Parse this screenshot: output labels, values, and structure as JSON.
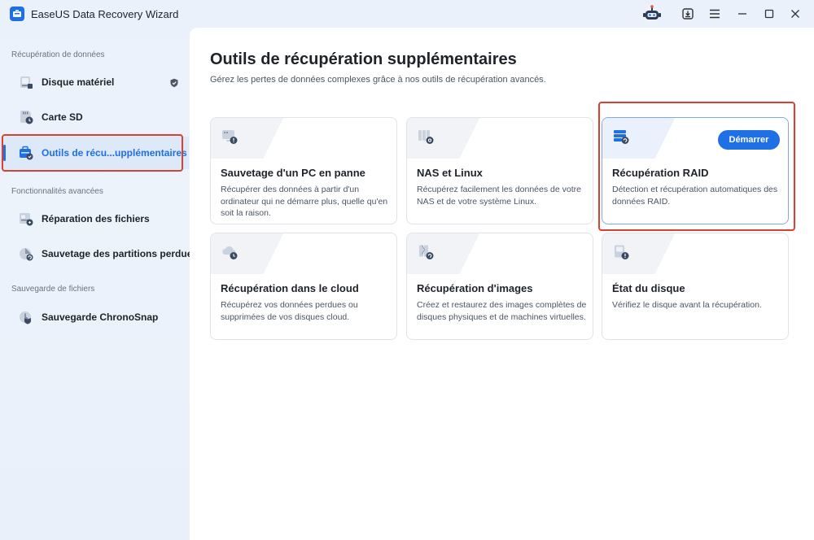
{
  "app": {
    "title": "EaseUS Data Recovery Wizard"
  },
  "titlebar": {
    "icons": [
      "robot-support-icon",
      "download-icon",
      "menu-icon",
      "minimize-icon",
      "maximize-icon",
      "close-icon"
    ]
  },
  "sidebar": {
    "sections": [
      {
        "label": "Récupération de données",
        "items": [
          {
            "label": "Disque matériel",
            "icon": "hard-disk-icon",
            "badge": "shield-icon"
          },
          {
            "label": "Carte SD",
            "icon": "sd-card-icon"
          },
          {
            "label": "Outils de récu...upplémentaires",
            "icon": "tools-icon",
            "active": true
          }
        ]
      },
      {
        "label": "Fonctionnalités avancées",
        "items": [
          {
            "label": "Réparation des fichiers",
            "icon": "file-repair-icon"
          },
          {
            "label": "Sauvetage des partitions perdues",
            "icon": "partition-icon"
          }
        ]
      },
      {
        "label": "Sauvegarde de fichiers",
        "items": [
          {
            "label": "Sauvegarde ChronoSnap",
            "icon": "chronosnap-icon"
          }
        ]
      }
    ]
  },
  "main": {
    "title": "Outils de récupération supplémentaires",
    "subtitle": "Gérez les pertes de données complexes grâce à nos outils de récupération avancés.",
    "cards": [
      {
        "title": "Sauvetage d'un PC en panne",
        "description": "Récupérer des données à partir d'un ordinateur qui ne démarre plus, quelle qu'en soit la raison.",
        "icon": "crashed-pc-icon"
      },
      {
        "title": "NAS et Linux",
        "description": "Récupérez facilement les données de votre NAS et de votre système Linux.",
        "icon": "nas-icon"
      },
      {
        "title": "Récupération RAID",
        "description": "Détection et récupération automatiques des données RAID.",
        "icon": "raid-icon",
        "button": "Démarrer",
        "selected": true
      },
      {
        "title": "Récupération dans le cloud",
        "description": "Récupérez vos données perdues ou supprimées de vos disques cloud.",
        "icon": "cloud-icon"
      },
      {
        "title": "Récupération d'images",
        "description": "Créez et restaurez des images complètes de disques physiques et de machines virtuelles.",
        "icon": "disk-image-icon"
      },
      {
        "title": "État du disque",
        "description": "Vérifiez le disque avant la récupération.",
        "icon": "disk-health-icon"
      }
    ]
  },
  "colors": {
    "accent": "#1f6fe5",
    "highlight": "#d9402f",
    "text": "#1f2329",
    "muted": "#4b5563"
  }
}
